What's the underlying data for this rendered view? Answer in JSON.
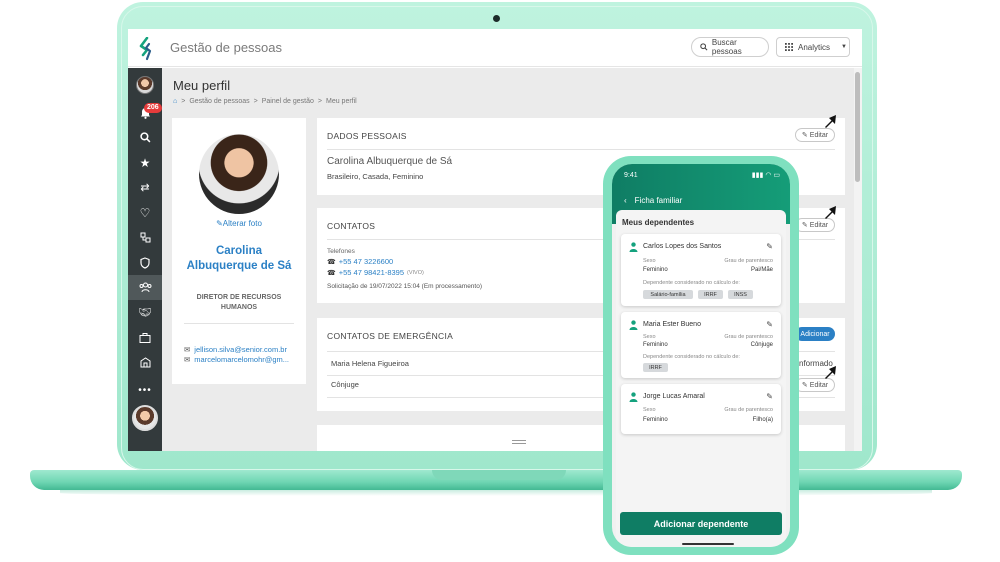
{
  "app": {
    "title": "Gestão de pessoas"
  },
  "toolbar": {
    "search_label": "Buscar pessoas",
    "analytics_label": "Analytics"
  },
  "sidebar": {
    "notification_count": "206"
  },
  "page": {
    "title": "Meu perfil",
    "breadcrumb": [
      "Gestão de pessoas",
      "Painel de gestão",
      "Meu perfil"
    ],
    "breadcrumb_sep": ">"
  },
  "profile": {
    "change_photo": "Alterar foto",
    "name": "Carolina Albuquerque de Sá",
    "role": "DIRETOR DE RECURSOS HUMANOS",
    "emails": [
      "jellison.silva@senior.com.br",
      "marcelomarcelomohr@gm..."
    ]
  },
  "personal": {
    "title": "DADOS PESSOAIS",
    "full_name": "Carolina Albuquerque de Sá",
    "details": "Brasileiro, Casada, Feminino",
    "edit_label": "Editar"
  },
  "contacts": {
    "title": "CONTATOS",
    "phones_label": "Telefones",
    "phone1": "+55 47 3226600",
    "phone2": "+55 47 98421-8395",
    "phone2_tag": "(VIVO)",
    "request_note": "Solicitação de 19/07/2022 15:04 (Em processamento)",
    "edit_label": "Editar"
  },
  "emergency": {
    "title": "CONTATOS DE EMERGÊNCIA",
    "add_label": "Adicionar",
    "contact_name": "Maria Helena Figueiroa",
    "contact_relation": "Cônjuge",
    "right_text": "nformado",
    "edit_label": "Editar"
  },
  "phone": {
    "time": "9:41",
    "header": "Ficha familiar",
    "section_title": "Meus dependentes",
    "labels": {
      "sexo": "Sexo",
      "grau": "Grau de parentesco",
      "calculo": "Dependente considerado no cálculo de:"
    },
    "dependents": [
      {
        "name": "Carlos Lopes dos Santos",
        "sexo": "Feminino",
        "grau": "Pai/Mãe",
        "tags": [
          "Salário-família",
          "IRRF",
          "INSS"
        ]
      },
      {
        "name": "Maria Ester Bueno",
        "sexo": "Feminino",
        "grau": "Cônjuge",
        "tags": [
          "IRRF"
        ]
      },
      {
        "name": "Jorge Lucas Amaral",
        "sexo": "Feminino",
        "grau": "Filho(a)",
        "tags": []
      }
    ],
    "button_label": "Adicionar dependente"
  },
  "colors": {
    "accent": "#2b80c5",
    "brand_green": "#0f7d64",
    "sidebar": "#333a3c",
    "frame": "#9fe7cc"
  }
}
